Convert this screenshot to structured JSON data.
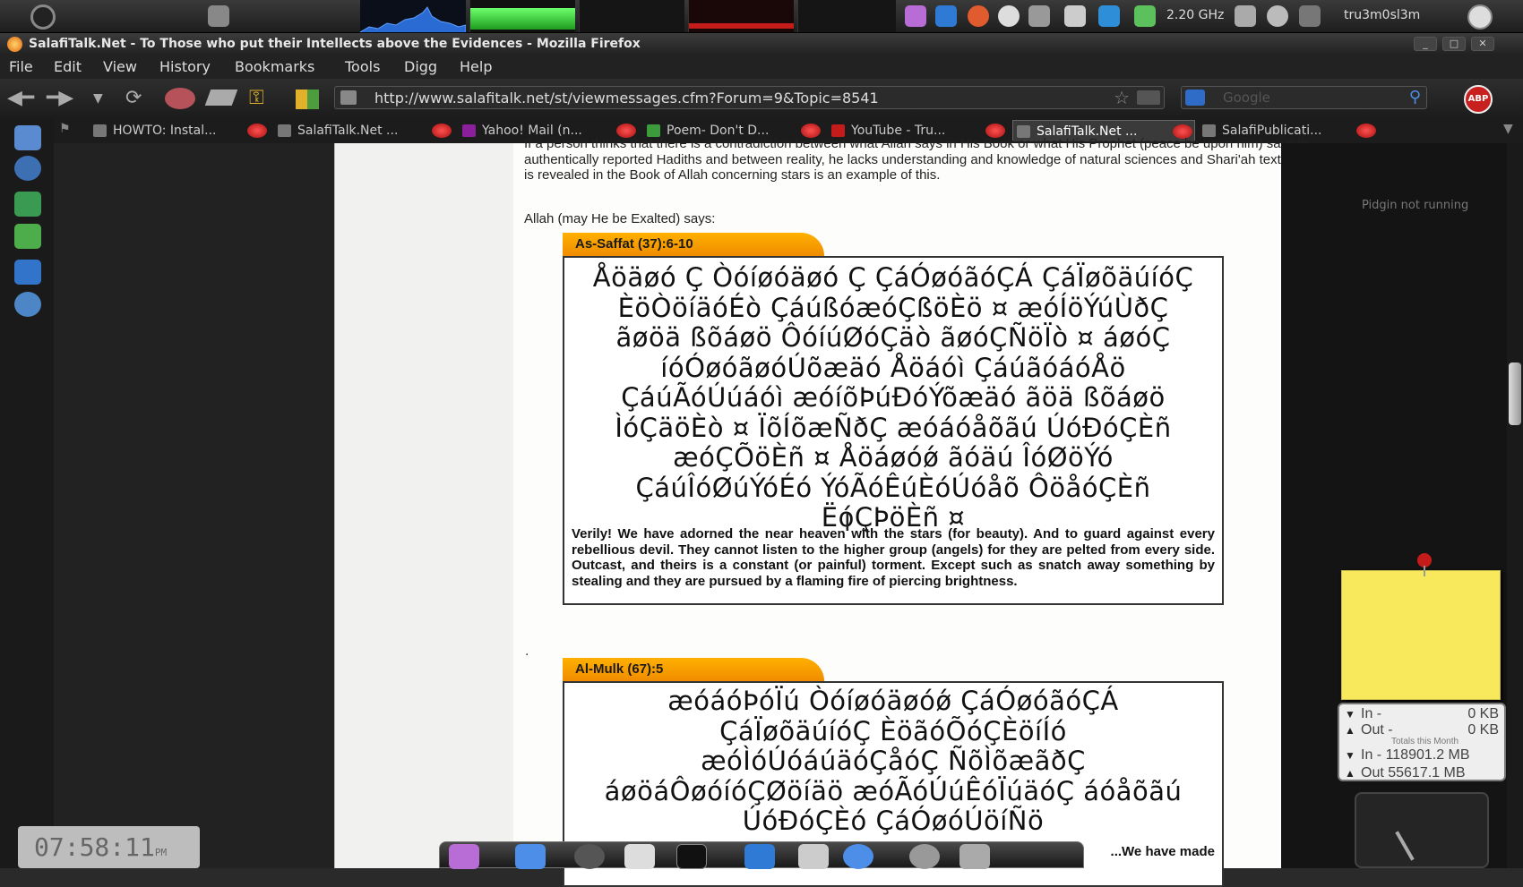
{
  "topbar": {
    "cpu_freq": "2.20 GHz",
    "username": "tru3m0sl3m"
  },
  "window": {
    "title": "SalafiTalk.Net - To Those who put their Intellects above the Evidences - Mozilla Firefox"
  },
  "menu": [
    "File",
    "Edit",
    "View",
    "History",
    "Bookmarks",
    "Tools",
    "Digg",
    "Help"
  ],
  "navigation": {
    "url": "http://www.salafitalk.net/st/viewmessages.cfm?Forum=9&Topic=8541",
    "search_placeholder": "Google",
    "abp_label": "ABP"
  },
  "tabs": [
    {
      "label": "HOWTO: Instal..."
    },
    {
      "label": "SalafiTalk.Net ..."
    },
    {
      "label": "Yahoo! Mail (n..."
    },
    {
      "label": "Poem- Don't D..."
    },
    {
      "label": "YouTube - Tru..."
    },
    {
      "label": "SalafiTalk.Net ...",
      "active": true
    },
    {
      "label": "SalafiPublicati..."
    }
  ],
  "article": {
    "intro": "If a person thinks that there is a contradiction between what Allah says in His Book or what His Prophet (peace be upon him) says in authentically reported Hadiths and between reality, he lacks understanding and knowledge of natural sciences and Shari'ah texts. What is revealed in the Book of Allah concerning stars is an example of this.",
    "allah_says": "Allah (may He be Exalted) says:",
    "verse1": {
      "ref": "As-Saffat (37):6-10",
      "arabic_lines": [
        "Åöäøó Ç Òóíøóäøó Ç ÇáÓøóãóÇÁ ÇáÏøõäúíóÇ",
        "ÈöÒöíäóÉò ÇáúßóæóÇßöÈö ¤ æóÍöÝúÙðÇ",
        "ãøöä ßõáøö ÔóíúØóÇäò ãøóÇÑöÏò ¤ áøóÇ",
        "íóÓøóãøóÚõæäó Åöáóì ÇáúãóáóÅö",
        "ÇáúÃóÚúáóì æóíõÞúÐóÝõæäó ãöä ßõáøö",
        "ÌóÇäöÈò ¤ ÏõÍõæÑðÇ æóáóåõãú ÚóÐóÇÈñ",
        "æóÇÕöÈñ ¤ Åöáøóǿ ãóäú ÎóØöÝó",
        "ÇáúÎóØúÝóÉó ÝóÃóÊúÈóÚóåõ ÔöåóÇÈñ",
        "ËóÇÞöÈñ ¤"
      ],
      "translation": "Verily! We have adorned the near heaven with the stars (for beauty). And to guard against every rebellious devil. They cannot listen to the higher group (angels) for they are pelted from every side. Outcast, and theirs is a constant (or painful) torment. Except such as snatch away something by stealing and they are pursued by a flaming fire of piercing brightness."
    },
    "verse2": {
      "ref": "Al-Mulk (67):5",
      "arabic_lines": [
        "æóáóÞóÏú Òóíøóäøóǿ ÇáÓøóãóÇÁ",
        "ÇáÏøõäúíóÇ ÈöãóÕóÇÈöíÍó",
        "æóÌóÚóáúäóÇåóÇ ÑõÌõæãðÇ",
        "áøöáÔøóíóÇØöíäö æóÃóÚúÊóÏúäóÇ áóåõãú",
        "ÚóÐóÇÈó ÇáÓøóÚöíÑö"
      ],
      "translation_partial": "...We have made"
    },
    "dot": "."
  },
  "sidebar_widgets": {
    "pidgin_status": "Pidgin not running",
    "netmon": {
      "in_label": "In -",
      "in_value": "0 KB",
      "out_label": "Out -",
      "out_value": "0 KB",
      "month_label": "Totals this Month",
      "in_total": "In - 118901.2 MB",
      "out_total": "Out 55617.1 MB"
    }
  },
  "clock": {
    "time": "07:58:11",
    "ampm": "PM"
  },
  "colors": {
    "verse_tab": "#f59a00",
    "sticky": "#f8e85c",
    "close_red": "#c41b1b"
  }
}
